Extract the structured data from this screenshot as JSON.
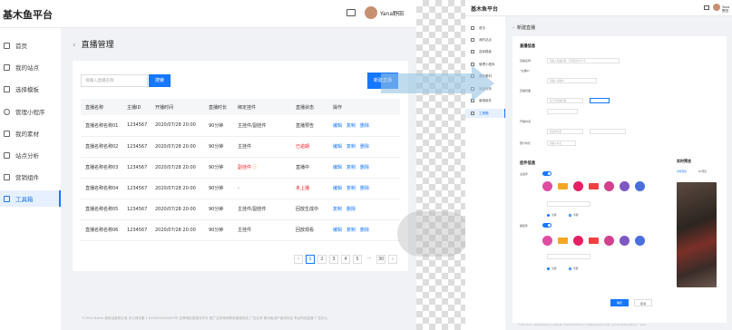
{
  "left": {
    "brand": "基木鱼平台",
    "user_name": "Yana野田",
    "nav": [
      {
        "icon": "home-icon",
        "label": "首页"
      },
      {
        "icon": "site-icon",
        "label": "我的站点"
      },
      {
        "icon": "template-icon",
        "label": "选择模板"
      },
      {
        "icon": "mini-program-icon",
        "label": "管理小程序"
      },
      {
        "icon": "material-icon",
        "label": "我的素材"
      },
      {
        "icon": "analytics-icon",
        "label": "站点分析"
      },
      {
        "icon": "marketing-icon",
        "label": "营销组件"
      },
      {
        "icon": "toolbox-icon",
        "label": "工具箱"
      }
    ],
    "page_title": "直播管理",
    "search_placeholder": "请输入直播名称",
    "search_button": "搜索",
    "new_button": "新建直播",
    "columns": [
      "直播名称",
      "主播ID",
      "开播时间",
      "直播时长",
      "绑定挂件",
      "直播状态",
      "操作"
    ],
    "rows": [
      {
        "name": "直播名称名称01",
        "id": "1234567",
        "time": "2020/07/28 20:00",
        "dur": "90分钟",
        "widget": "主挂件/副挂件",
        "status": "直播预告",
        "status_style": "normal",
        "ops": [
          "编辑",
          "复制",
          "删除"
        ],
        "widget_warn": false
      },
      {
        "name": "直播名称名称02",
        "id": "1234567",
        "time": "2020/07/28 20:00",
        "dur": "90分钟",
        "widget": "主挂件",
        "status": "已逾期",
        "status_style": "red",
        "ops": [
          "编辑",
          "复制",
          "删除"
        ],
        "widget_warn": false
      },
      {
        "name": "直播名称名称03",
        "id": "1234567",
        "time": "2020/07/28 20:00",
        "dur": "90分钟",
        "widget": "副挂件",
        "status": "直播中",
        "status_style": "normal",
        "ops": [
          "编辑",
          "复制",
          "删除"
        ],
        "widget_warn": true
      },
      {
        "name": "直播名称名称04",
        "id": "1234567",
        "time": "2020/07/28 20:00",
        "dur": "90分钟",
        "widget": "-",
        "status": "未上播",
        "status_style": "red",
        "ops": [
          "编辑",
          "复制",
          "删除"
        ],
        "widget_warn": false
      },
      {
        "name": "直播名称名称05",
        "id": "1234567",
        "time": "2020/07/28 20:00",
        "dur": "90分钟",
        "widget": "主挂件/副挂件",
        "status": "回放生成中",
        "status_style": "normal",
        "ops": [
          "复制",
          "删除"
        ],
        "widget_warn": false
      },
      {
        "name": "直播名称名称06",
        "id": "1234567",
        "time": "2020/07/28 20:00",
        "dur": "90分钟",
        "widget": "主挂件",
        "status": "回放观看",
        "status_style": "normal",
        "ops": [
          "编辑",
          "复制",
          "删除"
        ],
        "widget_warn": false
      }
    ],
    "pagination": {
      "prev": "‹",
      "pages": [
        "1",
        "2",
        "3",
        "4",
        "5"
      ],
      "ellipsis": "···",
      "last": "30",
      "next": "›",
      "current": "1"
    },
    "footer": "©2020 Baidu 使用百度前必读 京公网安备 11000002000001号 互联网信息服务许可 推广业务单体联系客服热线 广告业务 基木鱼用户使用协议 有证科技监管 广告中心"
  },
  "right": {
    "brand": "基木鱼平台",
    "user_name": "Yana野田",
    "nav": [
      "首页",
      "我的站点",
      "选择模板",
      "管理小程序",
      "我的素材",
      "站点分析",
      "营销组件",
      "工具箱"
    ],
    "page_title": "新建直播",
    "basic_section": "直播信息",
    "basic_fields": [
      {
        "label": "直播名称",
        "value": "请输入直播名称，不得超过15个字"
      },
      {
        "label": "*主播ID",
        "value": "请输入主播ID"
      },
      {
        "label": "直播封面",
        "value": "请上传直播封面"
      },
      {
        "label": "开播时间",
        "value": "请选择日期"
      },
      {
        "label": "预计时长",
        "value": "请输入时长"
      }
    ],
    "widget_section": "挂件信息",
    "main_widget_label": "主挂件",
    "sub_widget_label": "副挂件",
    "radio_options": [
      "全屏",
      "半屏"
    ],
    "preview_title": "实时预览",
    "preview_tabs": [
      "手机预览",
      "PC预览"
    ],
    "confirm_button": "确定",
    "cancel_button": "取消",
    "footer": "©2020 Baidu 使用百度前必读 京公网安备 11000002000001号 互联网信息服务许可 推广业务 基木鱼用户使用协议 广告中心"
  },
  "colors": {
    "primary": "#1677ff",
    "danger": "#f5222d",
    "warn": "#fa8c16"
  }
}
